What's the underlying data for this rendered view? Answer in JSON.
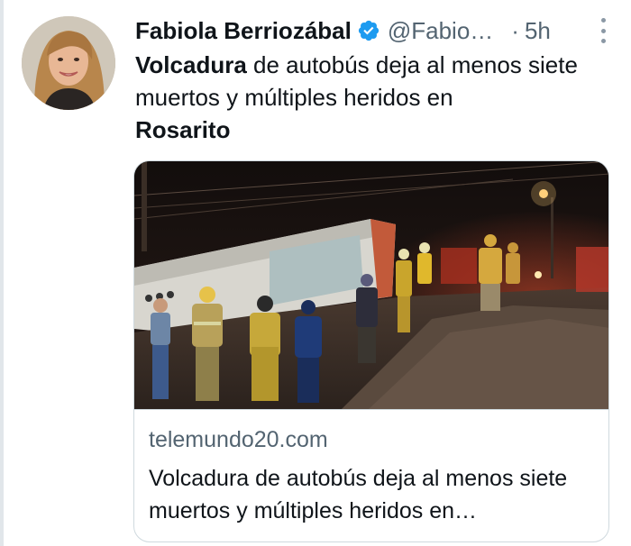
{
  "tweet": {
    "author_name": "Fabiola Berriozábal",
    "handle": "@Fabio…",
    "separator": "·",
    "time": "5h",
    "text_bold_1": "Volcadura",
    "text_middle": " de autobús deja al menos siete muertos y múltiples heridos en",
    "text_bold_2": "Rosarito"
  },
  "card": {
    "domain": "telemundo20.com",
    "title": "Volcadura de autobús deja al menos siete muertos y múltiples heridos en…"
  },
  "icons": {
    "verified": "verified-badge-icon",
    "more": "more-options-icon"
  },
  "colors": {
    "verified_blue": "#1d9bf0",
    "secondary_text": "#536471",
    "primary_text": "#0f1419",
    "border": "#cfd9de"
  }
}
